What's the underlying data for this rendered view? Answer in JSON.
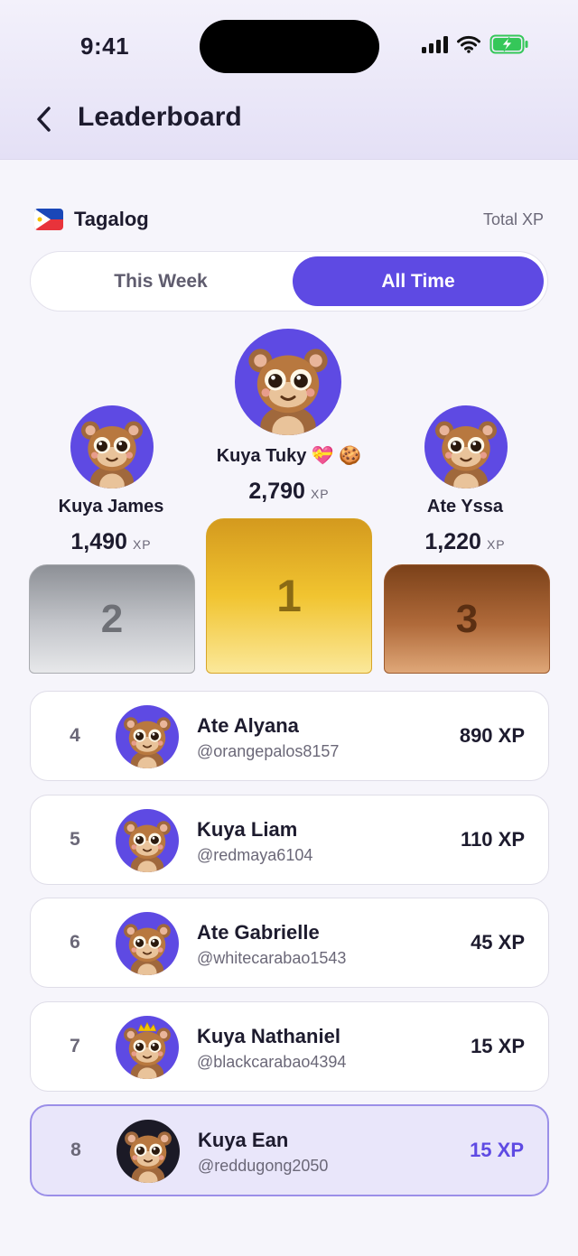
{
  "status_bar": {
    "time": "9:41"
  },
  "header": {
    "title": "Leaderboard"
  },
  "language": {
    "name": "Tagalog",
    "metric_label": "Total XP"
  },
  "tabs": [
    {
      "label": "This Week",
      "selected": false
    },
    {
      "label": "All Time",
      "selected": true
    }
  ],
  "podium": {
    "first": {
      "rank": "1",
      "name": "Kuya Tuky",
      "badges": "💝 🍪",
      "xp": "2,790",
      "unit": "XP"
    },
    "second": {
      "rank": "2",
      "name": "Kuya James",
      "xp": "1,490",
      "unit": "XP"
    },
    "third": {
      "rank": "3",
      "name": "Ate Yssa",
      "xp": "1,220",
      "unit": "XP"
    }
  },
  "rankings": [
    {
      "rank": "4",
      "name": "Ate Alyana",
      "username": "@orangepalos8157",
      "xp": "890 XP"
    },
    {
      "rank": "5",
      "name": "Kuya Liam",
      "username": "@redmaya6104",
      "xp": "110 XP"
    },
    {
      "rank": "6",
      "name": "Ate Gabrielle",
      "username": "@whitecarabao1543",
      "xp": "45 XP"
    },
    {
      "rank": "7",
      "name": "Kuya Nathaniel",
      "username": "@blackcarabao4394",
      "xp": "15 XP"
    },
    {
      "rank": "8",
      "name": "Kuya Ean",
      "username": "@reddugong2050",
      "xp": "15 XP",
      "current_user": true
    }
  ],
  "colors": {
    "accent": "#5e4ae3",
    "gold": "#e9b12a",
    "silver": "#c7c9ce",
    "bronze": "#b06a3a"
  }
}
